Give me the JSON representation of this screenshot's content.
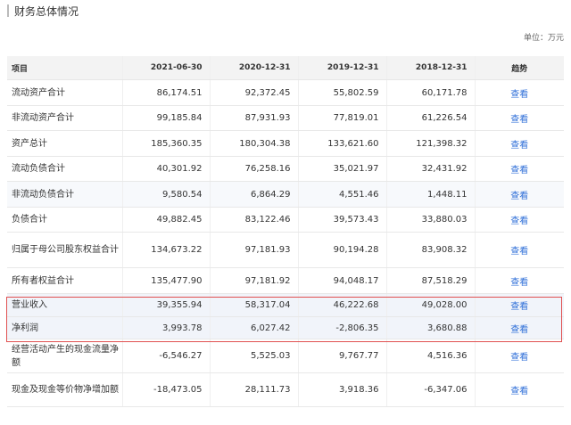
{
  "section_title": "财务总体情况",
  "unit_label": "单位：万元",
  "columns": [
    "项目",
    "2021-06-30",
    "2020-12-31",
    "2019-12-31",
    "2018-12-31",
    "趋势"
  ],
  "link_label": "查看",
  "rows": [
    {
      "item": "流动资产合计",
      "v": [
        "86,174.51",
        "92,372.45",
        "55,802.59",
        "60,171.78"
      ]
    },
    {
      "item": "非流动资产合计",
      "v": [
        "99,185.84",
        "87,931.93",
        "77,819.01",
        "61,226.54"
      ]
    },
    {
      "item": "资产总计",
      "v": [
        "185,360.35",
        "180,304.38",
        "133,621.60",
        "121,398.32"
      ]
    },
    {
      "item": "流动负债合计",
      "v": [
        "40,301.92",
        "76,258.16",
        "35,021.97",
        "32,431.92"
      ]
    },
    {
      "item": "非流动负债合计",
      "v": [
        "9,580.54",
        "6,864.29",
        "4,551.46",
        "1,448.11"
      ]
    },
    {
      "item": "负债合计",
      "v": [
        "49,882.45",
        "83,122.46",
        "39,573.43",
        "33,880.03"
      ]
    },
    {
      "item": "归属于母公司股东权益合计",
      "v": [
        "134,673.22",
        "97,181.93",
        "90,194.28",
        "83,908.32"
      ]
    },
    {
      "item": "所有者权益合计",
      "v": [
        "135,477.90",
        "97,181.92",
        "94,048.17",
        "87,518.29"
      ]
    },
    {
      "item": "营业收入",
      "v": [
        "39,355.94",
        "58,317.04",
        "46,222.68",
        "49,028.00"
      ]
    },
    {
      "item": "净利润",
      "v": [
        "3,993.78",
        "6,027.42",
        "-2,806.35",
        "3,680.88"
      ]
    },
    {
      "item": "经营活动产生的现金流量净额",
      "v": [
        "-6,546.27",
        "5,525.03",
        "9,767.77",
        "4,516.36"
      ]
    },
    {
      "item": "现金及现金等价物净增加额",
      "v": [
        "-18,473.05",
        "28,111.73",
        "3,918.36",
        "-6,347.06"
      ]
    }
  ]
}
